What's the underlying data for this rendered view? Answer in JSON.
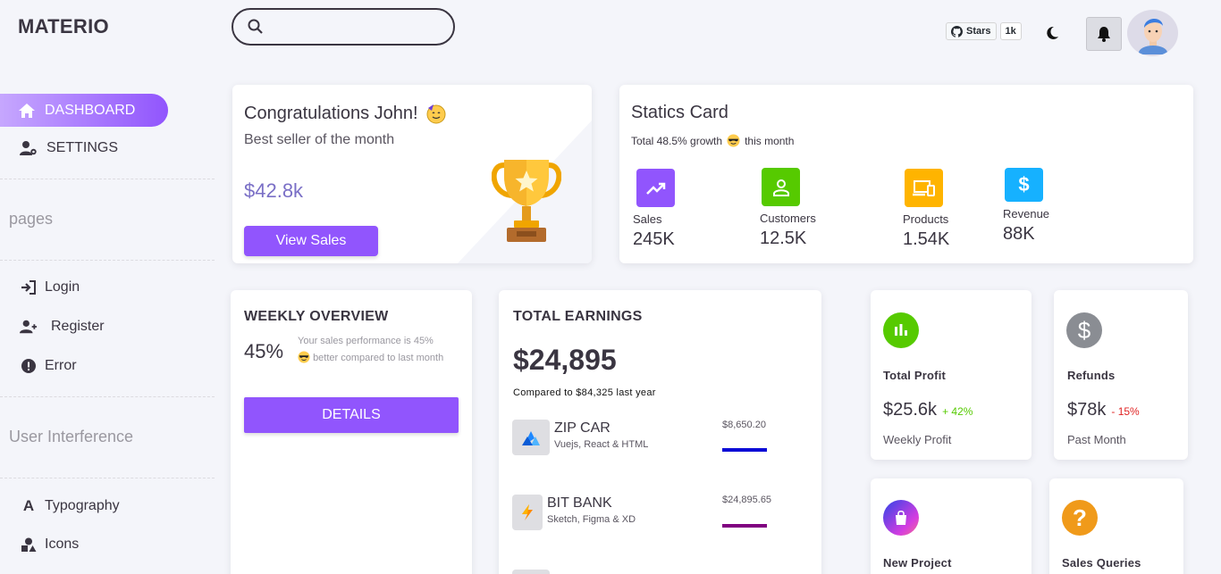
{
  "brand": "MATERIO",
  "nav": {
    "dashboard": "DASHBOARD",
    "settings": "SETTINGS",
    "section_pages": "pages",
    "login": "Login",
    "register": "Register",
    "error": "Error",
    "section_ui": "User Interference",
    "typography": "Typography",
    "icons": "Icons"
  },
  "header": {
    "search_placeholder": "",
    "github_stars_label": "Stars",
    "github_stars_count": "1k"
  },
  "congrats": {
    "title": "Congratulations John!",
    "subtitle": "Best seller of the month",
    "amount": "$42.8k",
    "button": "View Sales"
  },
  "statics": {
    "title": "Statics Card",
    "subtitle_pre": "Total 48.5% growth",
    "subtitle_post": "this month",
    "items": [
      {
        "label": "Sales",
        "value": "245K",
        "color": "#9155fd",
        "icon": "trending-up-icon"
      },
      {
        "label": "Customers",
        "value": "12.5K",
        "color": "#56ca00",
        "icon": "account-icon"
      },
      {
        "label": "Products",
        "value": "1.54K",
        "color": "#ffb400",
        "icon": "devices-icon"
      },
      {
        "label": "Revenue",
        "value": "88K",
        "color": "#16b1ff",
        "icon": "dollar-icon"
      }
    ]
  },
  "weekly": {
    "title": "WEEKLY OVERVIEW",
    "percent": "45%",
    "text_pre": "Your sales performance is 45%",
    "text_post": "better compared to last month",
    "button": "DETAILS"
  },
  "earnings": {
    "title": "TOTAL EARNINGS",
    "amount": "$24,895",
    "compare": "Compared to $84,325 last year",
    "items": [
      {
        "name": "ZIP CAR",
        "tags": "Vuejs, React & HTML",
        "amount": "$8,650.20",
        "color": "#0a0ad6"
      },
      {
        "name": "BIT BANK",
        "tags": "Sketch, Figma & XD",
        "amount": "$24,895.65",
        "color": "#800080"
      }
    ]
  },
  "profit": {
    "title": "Total Profit",
    "value": "$25.6k",
    "change": "+ 42%",
    "sub": "Weekly Profit",
    "color": "#56ca00",
    "change_color": "#56ca00"
  },
  "refunds": {
    "title": "Refunds",
    "value": "$78k",
    "change": "- 15%",
    "sub": "Past Month",
    "color": "#8a8d93",
    "change_color": "#ff4c51"
  },
  "new_project": {
    "title": "New Project"
  },
  "sales_queries": {
    "title": "Sales Queries",
    "color": "#f09a1a"
  }
}
